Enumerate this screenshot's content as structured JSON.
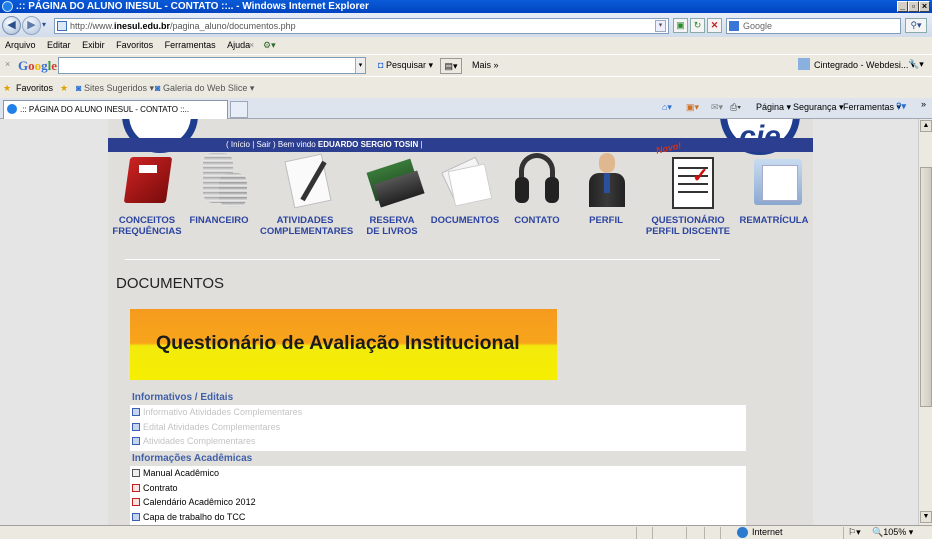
{
  "window": {
    "title": ".:: PÁGINA DO ALUNO INESUL - CONTATO ::.. - Windows Internet Explorer"
  },
  "address": {
    "url_prefix": "http://www.",
    "url_host": "inesul.edu.br",
    "url_path": "/pagina_aluno/documentos.php",
    "search_placeholder": "Google"
  },
  "menu": [
    "Arquivo",
    "Editar",
    "Exibir",
    "Favoritos",
    "Ferramentas",
    "Ajuda"
  ],
  "google_toolbar": {
    "logo": "Google",
    "search_label": "Pesquisar",
    "more_label": "Mais »",
    "account": "Cintegrado - Webdesi..."
  },
  "favorites_bar": {
    "favorites": "Favoritos",
    "suggested": "Sites Sugeridos",
    "gallery": "Galeria do Web Slice"
  },
  "tab": {
    "title": ".:: PÁGINA DO ALUNO INESUL - CONTATO ::.."
  },
  "command_bar": {
    "page": "Página",
    "security": "Segurança",
    "tools": "Ferramentas"
  },
  "header": {
    "links": "( Início | Sair ) Bem vindo",
    "user": "EDUARDO SERGIO TOSIN",
    "end": "|"
  },
  "nav": [
    {
      "line1": "CONCEITOS",
      "line2": "FREQUÊNCIAS",
      "icon": "book-icon"
    },
    {
      "line1": "FINANCEIRO",
      "line2": "",
      "icon": "coins-icon"
    },
    {
      "line1": "ATIVIDADES",
      "line2": "COMPLEMENTARES",
      "icon": "pen-paper-icon"
    },
    {
      "line1": "RESERVA",
      "line2": "DE LIVROS",
      "icon": "books-icon"
    },
    {
      "line1": "DOCUMENTOS",
      "line2": "",
      "icon": "papers-icon"
    },
    {
      "line1": "CONTATO",
      "line2": "",
      "icon": "headset-icon"
    },
    {
      "line1": "PERFIL",
      "line2": "",
      "icon": "person-icon"
    },
    {
      "line1": "QUESTIONÁRIO",
      "line2": "PERFIL DISCENTE",
      "icon": "checklist-icon",
      "badge": "Novo!"
    },
    {
      "line1": "REMATRÍCULA",
      "line2": "",
      "icon": "folder-icon"
    }
  ],
  "page_title": "DOCUMENTOS",
  "banner": "Questionário de Avaliação Institucional",
  "sections": [
    {
      "title": "Informativos / Editais",
      "items": [
        {
          "label": "Informativo Atividades Complementares",
          "type": "doc",
          "dim": true
        },
        {
          "label": "Edital Atividades Complementares",
          "type": "doc",
          "dim": true
        },
        {
          "label": "Atividades Complementares",
          "type": "doc",
          "dim": true
        }
      ]
    },
    {
      "title": "Informações Acadêmicas",
      "items": [
        {
          "label": "Manual Acadêmico",
          "type": "word",
          "dim": false
        },
        {
          "label": "Contrato",
          "type": "pdf",
          "dim": false
        },
        {
          "label": "Calendário Acadêmico 2012",
          "type": "pdf",
          "dim": false
        },
        {
          "label": "Capa de trabalho do TCC",
          "type": "doc",
          "dim": false
        }
      ]
    }
  ],
  "status": {
    "zone": "Internet",
    "zoom": "105%"
  }
}
